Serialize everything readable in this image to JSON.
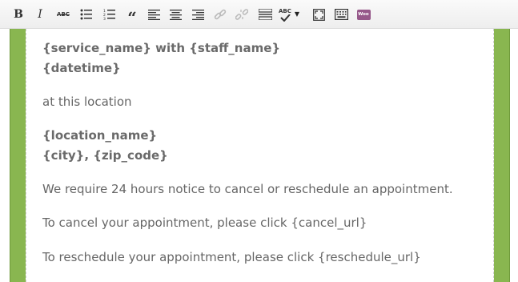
{
  "toolbar": {
    "buttons": [
      {
        "name": "bold-button",
        "icon": "bold-icon",
        "label": "B"
      },
      {
        "name": "italic-button",
        "icon": "italic-icon",
        "label": "I"
      },
      {
        "name": "strikethrough-button",
        "icon": "strikethrough-icon",
        "label": "ABC"
      },
      {
        "name": "bullet-list-button",
        "icon": "bullet-list-icon"
      },
      {
        "name": "numbered-list-button",
        "icon": "numbered-list-icon"
      },
      {
        "name": "blockquote-button",
        "icon": "blockquote-icon",
        "label": "“"
      },
      {
        "name": "align-left-button",
        "icon": "align-left-icon"
      },
      {
        "name": "align-center-button",
        "icon": "align-center-icon"
      },
      {
        "name": "align-right-button",
        "icon": "align-right-icon"
      },
      {
        "name": "insert-link-button",
        "icon": "link-icon",
        "disabled": true
      },
      {
        "name": "remove-link-button",
        "icon": "unlink-icon",
        "disabled": true
      },
      {
        "name": "read-more-button",
        "icon": "read-more-icon"
      },
      {
        "name": "spellcheck-button",
        "icon": "spellcheck-icon",
        "label": "ABC"
      },
      {
        "name": "fullscreen-button",
        "icon": "fullscreen-icon"
      },
      {
        "name": "toolbar-toggle-button",
        "icon": "keyboard-icon"
      },
      {
        "name": "woocommerce-button",
        "icon": "woo-icon",
        "label": "Woo"
      }
    ]
  },
  "editor": {
    "line1": "{service_name} with {staff_name}",
    "line2": "{datetime}",
    "line3": "at this location",
    "line4": "{location_name}",
    "line5": "{city}, {zip_code}",
    "line6": "We require 24 hours notice to cancel or reschedule an appointment.",
    "line7": "To cancel your appointment, please click {cancel_url}",
    "line8": "To reschedule your appointment, please click {reschedule_url}"
  },
  "colors": {
    "frame_green": "#89b650",
    "text": "#666666",
    "woo_purple": "#96588a"
  }
}
